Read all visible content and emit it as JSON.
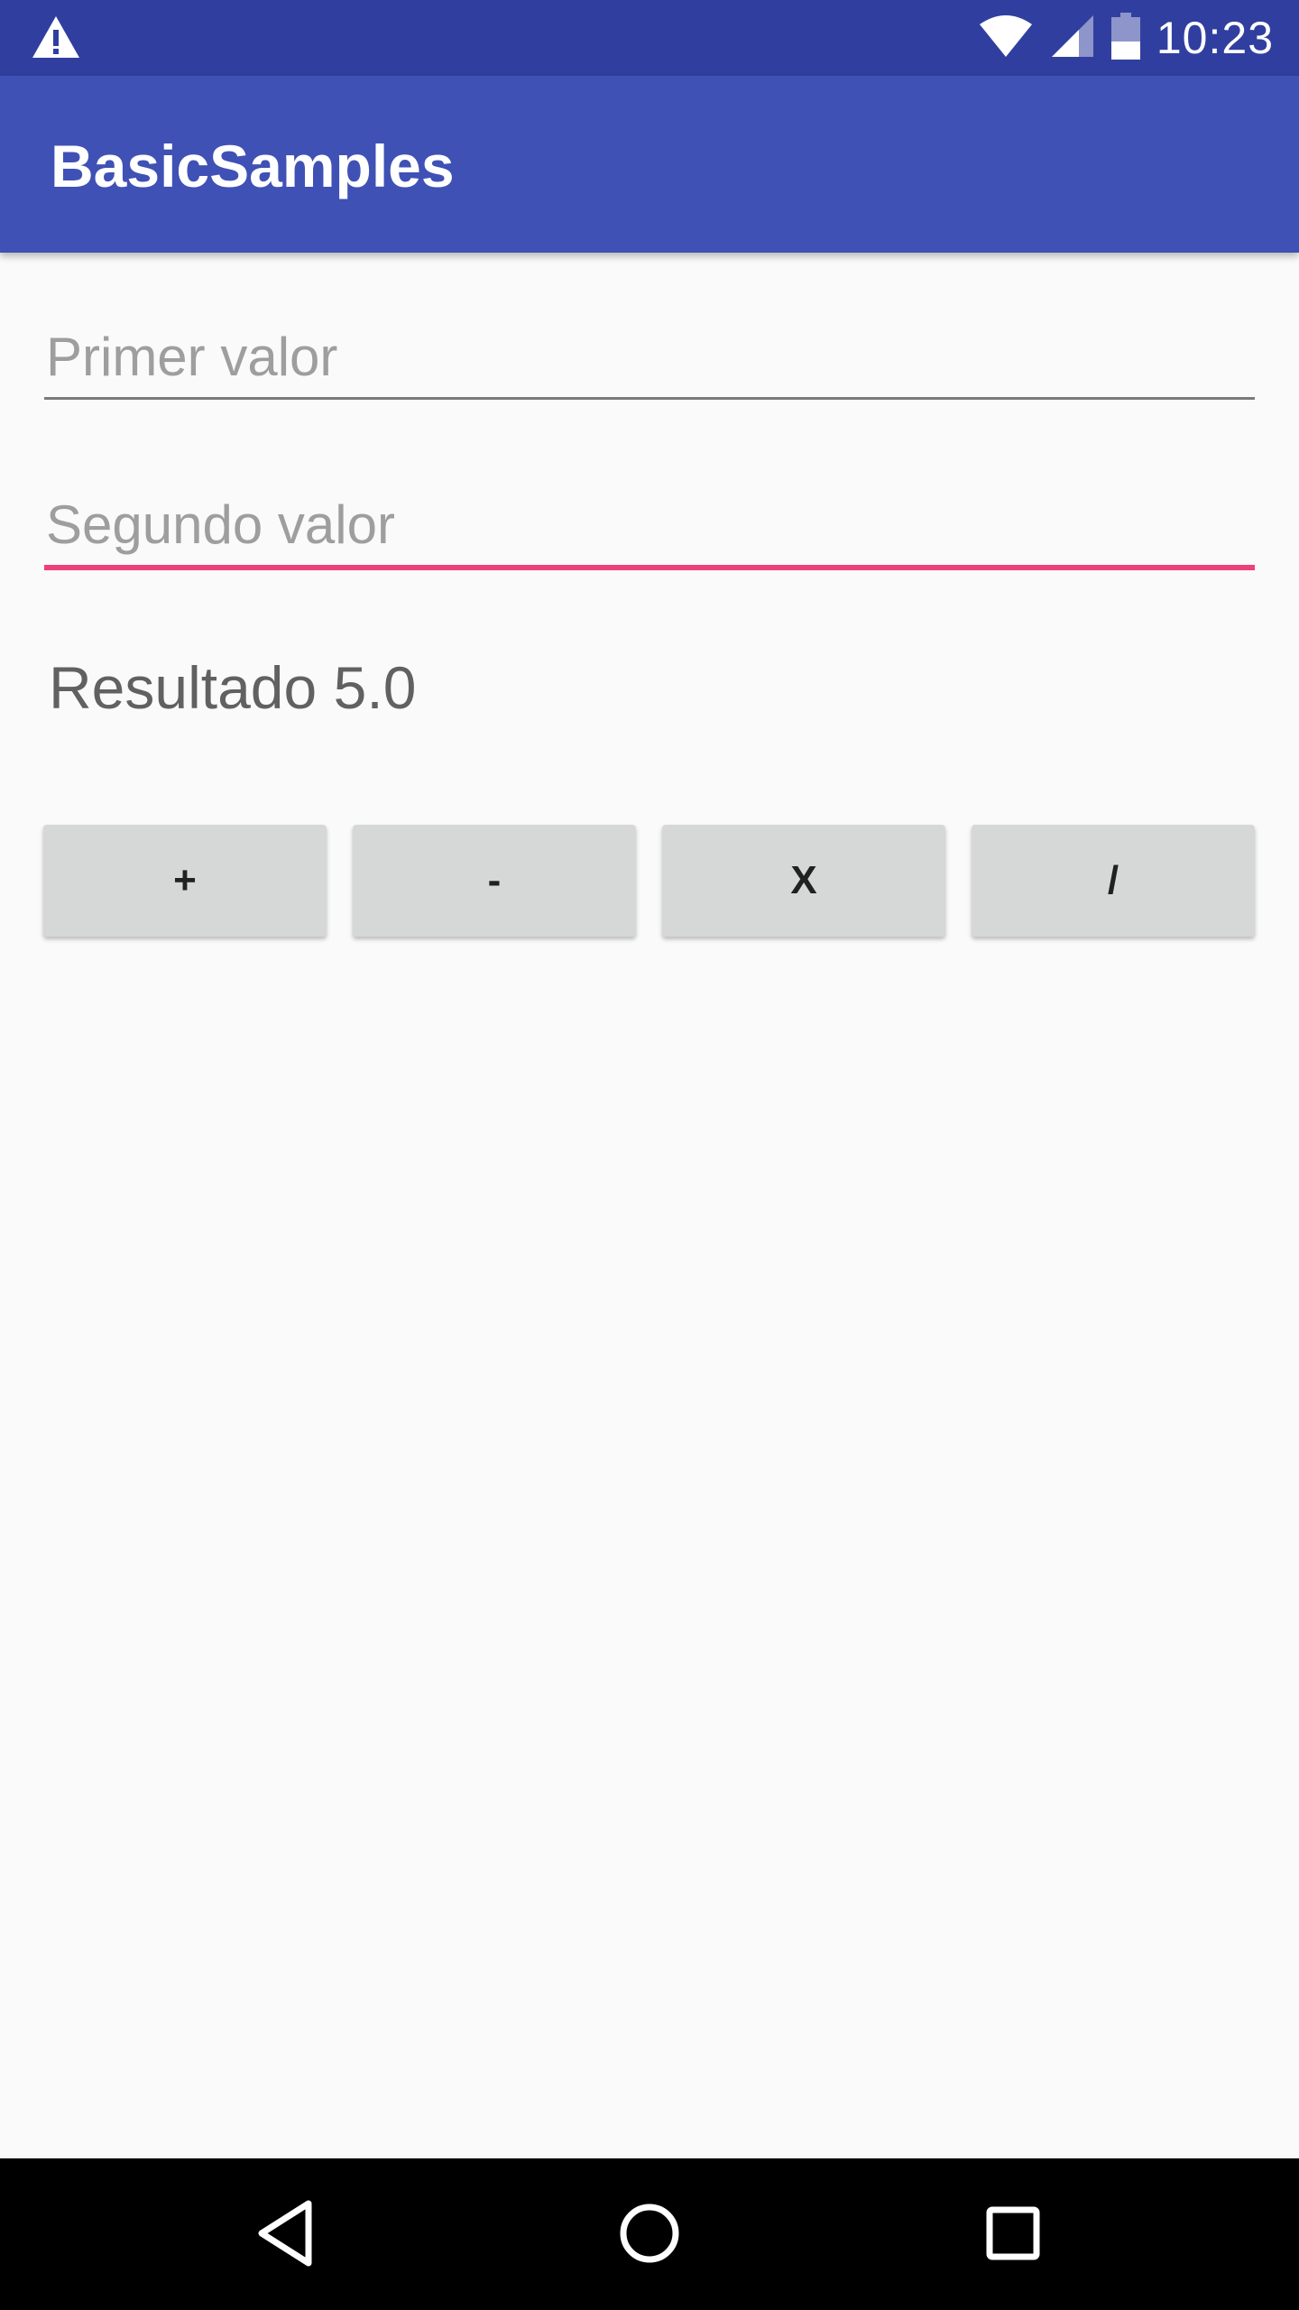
{
  "status_bar": {
    "time": "10:23",
    "icons": [
      "warning-icon",
      "wifi-icon",
      "signal-icon",
      "battery-icon"
    ],
    "color": "#303F9F"
  },
  "app_bar": {
    "title": "BasicSamples",
    "color": "#3F51B5"
  },
  "form": {
    "first_value": {
      "placeholder": "Primer valor",
      "value": ""
    },
    "second_value": {
      "placeholder": "Segundo valor",
      "value": "",
      "focused": true
    },
    "result_label": "Resultado",
    "result_value": "5.0",
    "accent_color": "#EC407A"
  },
  "operations": {
    "add_label": "+",
    "subtract_label": "-",
    "multiply_label": "X",
    "divide_label": "/"
  },
  "nav_bar": {
    "icons": [
      "back-icon",
      "home-icon",
      "recent-apps-icon"
    ]
  }
}
